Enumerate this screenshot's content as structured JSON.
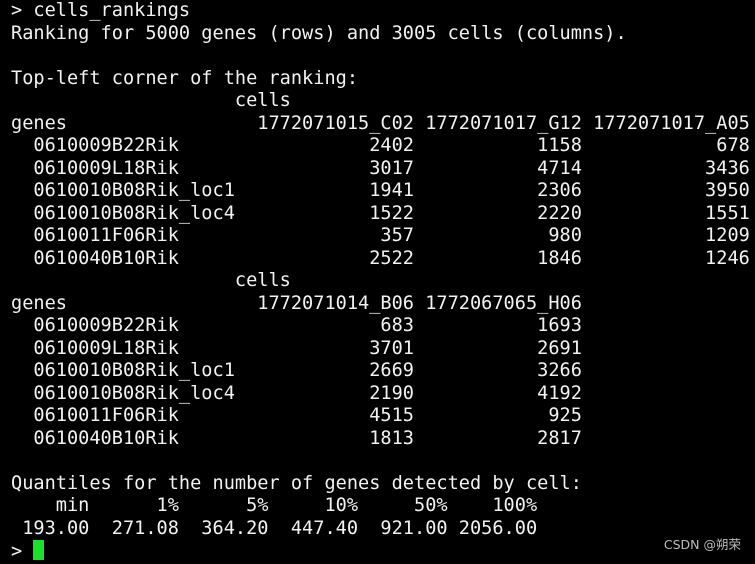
{
  "terminal": {
    "lines": [
      "> cells_rankings",
      "Ranking for 5000 genes (rows) and 3005 cells (columns).",
      "",
      "Top-left corner of the ranking:",
      "                    cells",
      "genes                 1772071015_C02 1772071017_G12 1772071017_A05",
      "  0610009B22Rik                 2402           1158            678",
      "  0610009L18Rik                 3017           4714           3436",
      "  0610010B08Rik_loc1            1941           2306           3950",
      "  0610010B08Rik_loc4            1522           2220           1551",
      "  0610011F06Rik                  357            980           1209",
      "  0610040B10Rik                 2522           1846           1246",
      "                    cells",
      "genes                 1772071014_B06 1772067065_H06",
      "  0610009B22Rik                  683           1693",
      "  0610009L18Rik                 3701           2691",
      "  0610010B08Rik_loc1            2669           3266",
      "  0610010B08Rik_loc4            2190           4192",
      "  0610011F06Rik                 4515            925",
      "  0610040B10Rik                 1813           2817",
      "",
      "Quantiles for the number of genes detected by cell:",
      "    min      1%      5%     10%     50%    100% ",
      " 193.00  271.08  364.20  447.40  921.00 2056.00 "
    ],
    "prompt": "> ",
    "cursor_color": "#17e32a"
  },
  "watermark": "CSDN @朔荣"
}
